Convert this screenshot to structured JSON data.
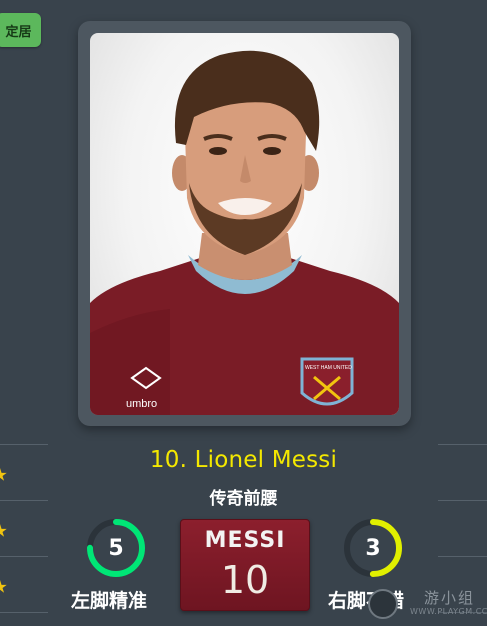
{
  "side_button": {
    "label": "定居"
  },
  "player": {
    "name": "10. Lionel Messi",
    "role": "传奇前腰"
  },
  "kit": {
    "shirt_text": "umbro",
    "badge_text": "WEST HAM UNITED"
  },
  "skills": {
    "left": {
      "value": "5",
      "label": "左脚精准",
      "fill_fraction": 0.75,
      "color": "#00e676"
    },
    "right": {
      "value": "3",
      "label": "右脚不错",
      "fill_fraction": 0.5,
      "color": "#e1f000"
    }
  },
  "jersey": {
    "name": "MESSI",
    "number": "10"
  },
  "watermark": {
    "cn": "游小组",
    "en": "WWW.PLAYGM.CC"
  },
  "colors": {
    "background": "#39434c",
    "name_yellow": "#f4e800",
    "jersey_red": "#8c1f2d",
    "button_green": "#5cb85c"
  }
}
